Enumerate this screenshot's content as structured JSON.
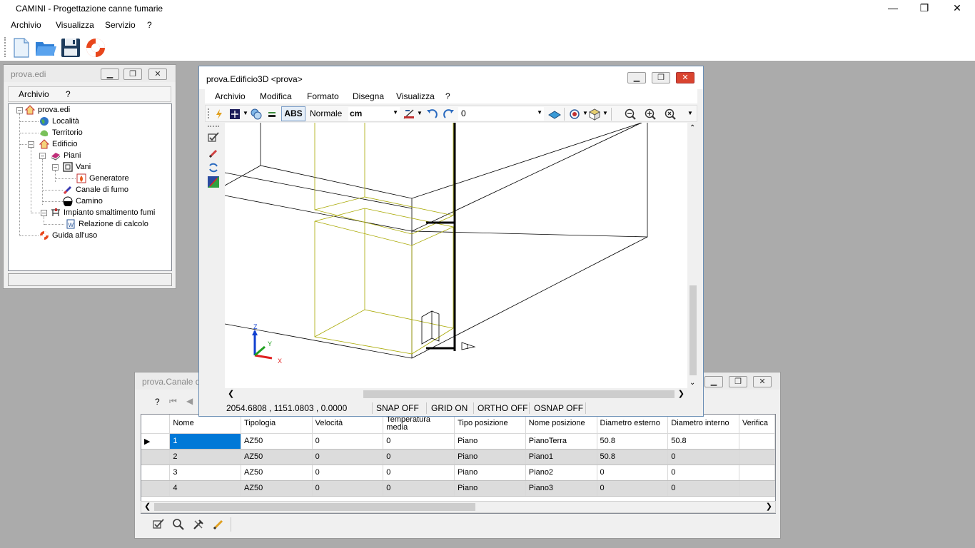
{
  "app": {
    "title": "CAMINI - Progettazione canne fumarie",
    "menu": [
      "Archivio",
      "Visualizza",
      "Servizio",
      "?"
    ]
  },
  "tree_window": {
    "title": "prova.edi",
    "menu": [
      "Archivio",
      "?"
    ],
    "items": [
      {
        "label": "prova.edi"
      },
      {
        "label": "Località"
      },
      {
        "label": "Territorio"
      },
      {
        "label": "Edificio"
      },
      {
        "label": "Piani"
      },
      {
        "label": "Vani"
      },
      {
        "label": "Generatore"
      },
      {
        "label": "Canale di fumo"
      },
      {
        "label": "Camino"
      },
      {
        "label": "Impianto smaltimento fumi"
      },
      {
        "label": "Relazione di calcolo"
      },
      {
        "label": "Guida all'uso"
      }
    ]
  },
  "win3d": {
    "title": "prova.Edificio3D <prova>",
    "menu": [
      "Archivio",
      "Modifica",
      "Formato",
      "Disegna",
      "Visualizza",
      "?"
    ],
    "toolbar": {
      "abs": "ABS",
      "style": "Normale",
      "unit": "cm",
      "layer": "0"
    },
    "axes": {
      "z": "Z",
      "y": "Y",
      "x": "X"
    },
    "status": {
      "coords": "2054.6808 , 1151.0803 , 0.0000",
      "snap": "SNAP OFF",
      "grid": "GRID ON",
      "ortho": "ORTHO OFF",
      "osnap": "OSNAP OFF"
    }
  },
  "grid_window": {
    "title": "prova.Canale d",
    "nav_help": "?",
    "columns": [
      "Nome",
      "Tipologia",
      "Velocità",
      "Temperatura media",
      "Tipo posizione",
      "Nome posizione",
      "Diametro esterno",
      "Diametro interno",
      "Verifica"
    ],
    "rows": [
      [
        "1",
        "AZ50",
        "0",
        "0",
        "Piano",
        "PianoTerra",
        "50.8",
        "50.8",
        ""
      ],
      [
        "2",
        "AZ50",
        "0",
        "0",
        "Piano",
        "Piano1",
        "50.8",
        "0",
        ""
      ],
      [
        "3",
        "AZ50",
        "0",
        "0",
        "Piano",
        "Piano2",
        "0",
        "0",
        ""
      ],
      [
        "4",
        "AZ50",
        "0",
        "0",
        "Piano",
        "Piano3",
        "0",
        "0",
        ""
      ]
    ]
  },
  "colors": {
    "selection": "#0078d7",
    "drawing_yellow": "#a8a800",
    "window_border": "#6b8fb5"
  }
}
